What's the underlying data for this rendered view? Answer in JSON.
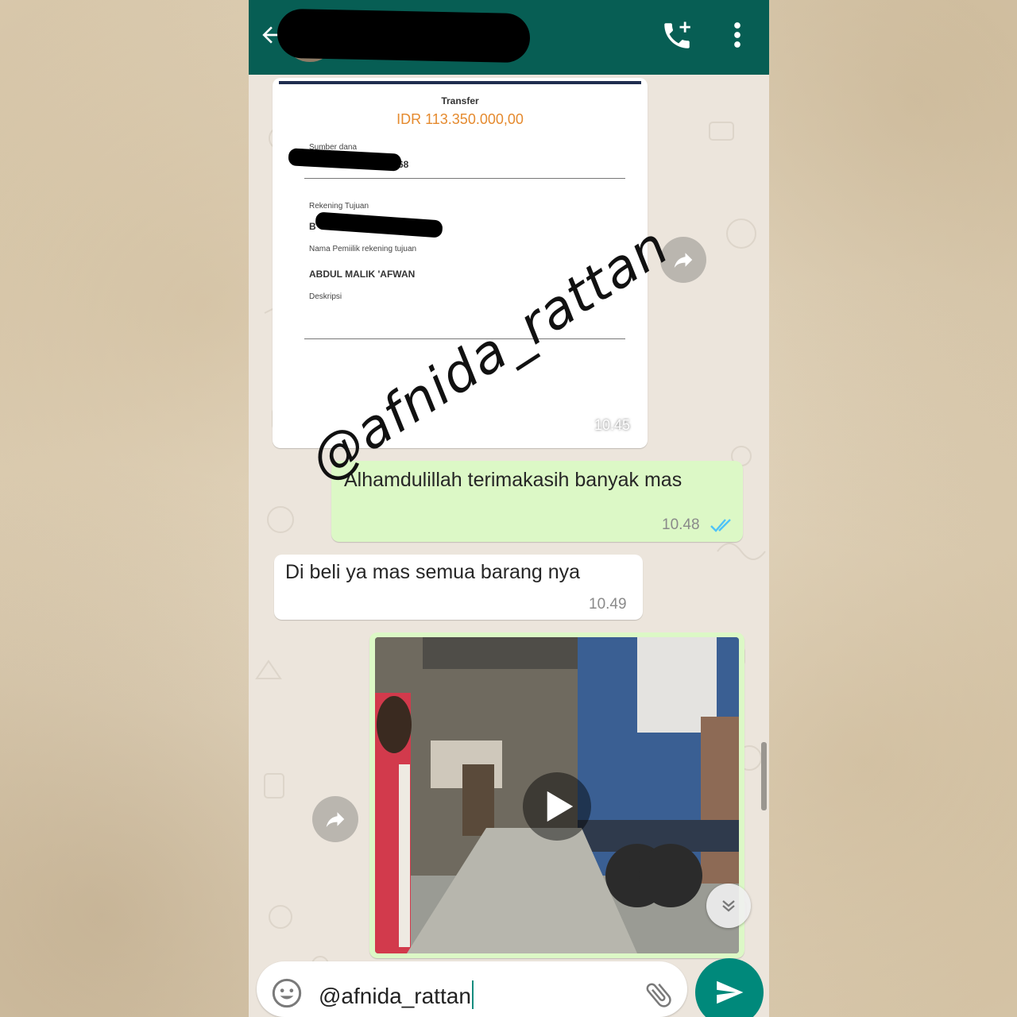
{
  "receipt": {
    "title": "Transfer",
    "amount": "IDR 113.350.000,00",
    "source_label": "Sumber dana",
    "source_value_suffix": "68",
    "destination_label": "Rekening Tujuan",
    "destination_value_prefix": "B",
    "owner_label": "Nama Pemiilik rekening tujuan",
    "owner_name": "ABDUL MALIK 'AFWAN",
    "description_label": "Deskripsi",
    "time": "10.45"
  },
  "messages": [
    {
      "direction": "outgoing",
      "text": "Alhamdulillah terimakasih banyak mas",
      "time": "10.48",
      "status": "read"
    },
    {
      "direction": "incoming",
      "text": "Di beli ya mas semua  barang nya",
      "time": "10.49"
    }
  ],
  "composer": {
    "text": "@afnida_rattan"
  },
  "watermark": "@afnida_rattan",
  "colors": {
    "header": "#075e54",
    "outgoing_bubble": "#dcf8c6",
    "read_ticks": "#4fc3f7",
    "send_button": "#00897b",
    "amount": "#e58a2e"
  },
  "icons": [
    "back-arrow-icon",
    "add-call-icon",
    "more-vert-icon",
    "forward-icon",
    "play-icon",
    "chevron-double-down-icon",
    "emoji-icon",
    "attach-icon",
    "send-icon"
  ]
}
